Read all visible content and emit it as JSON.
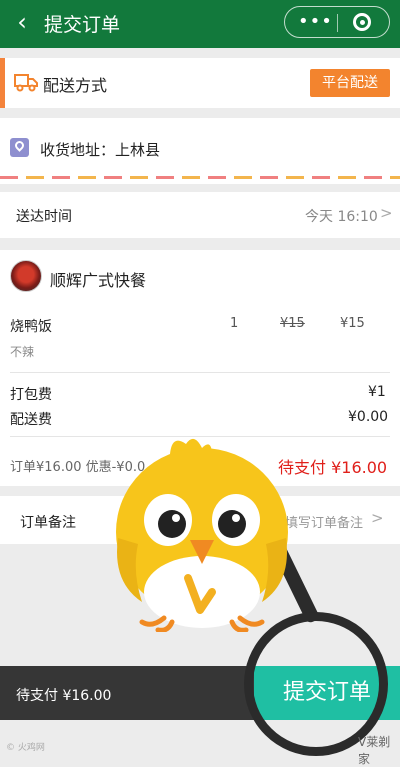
{
  "header": {
    "title": "提交订单",
    "back_icon": "chevron-left-icon",
    "more_icon": "more-dots-icon",
    "close_icon": "target-icon",
    "bg": "#12793c"
  },
  "delivery": {
    "label": "配送方式",
    "icon": "truck-icon",
    "method_button": "平台配送",
    "accent": "#f3842e"
  },
  "address": {
    "icon": "location-pin-icon",
    "label": "收货地址：上林县"
  },
  "delivery_time": {
    "label": "送达时间",
    "value": "今天 16:10",
    "chevron": ">"
  },
  "order": {
    "shop_name": "顺辉广式快餐",
    "item": {
      "name": "烧鸭饭",
      "note": "不辣",
      "qty": "1",
      "original_price": "¥15",
      "price": "¥15"
    },
    "packing_fee": {
      "label": "打包费",
      "value": "¥1"
    },
    "delivery_fee": {
      "label": "配送费",
      "value": "¥0.00"
    },
    "summary": "订单¥16.00 优惠-¥0.0",
    "to_pay": "待支付 ¥16.00"
  },
  "remark": {
    "label": "订单备注",
    "hint": "请填写订单备注",
    "chevron": ">"
  },
  "bottom_bar": {
    "to_pay": "待支付 ¥16.00",
    "submit_label": "提交订单",
    "submit_color": "#1fbfa3"
  },
  "watermark": {
    "left": "© 火鸡网",
    "right": "V莱剃家"
  }
}
